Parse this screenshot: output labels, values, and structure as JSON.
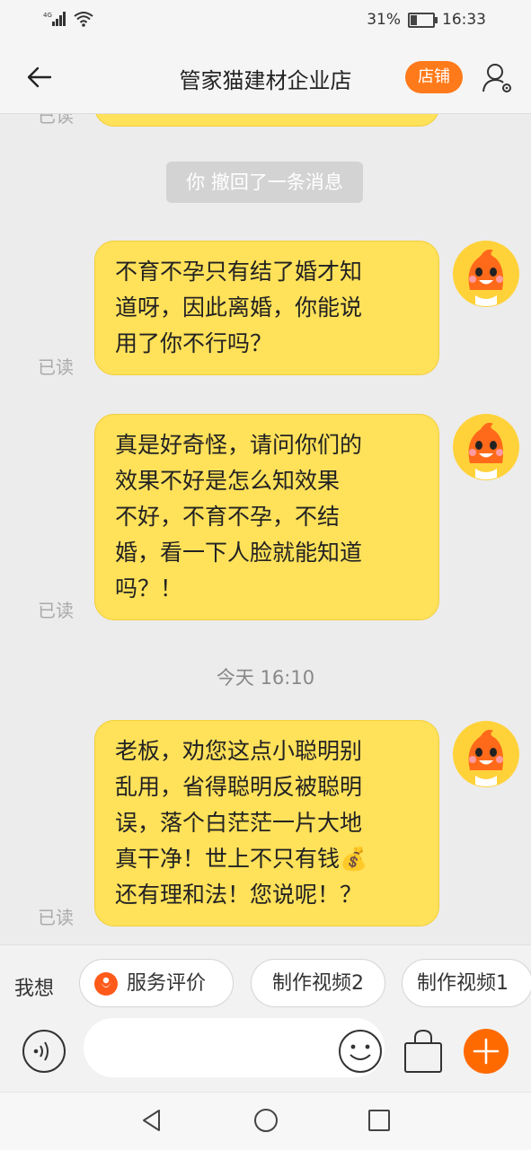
{
  "status_bar": {
    "network": "4G",
    "battery_text": "31%",
    "battery_level": 0.31,
    "time": "16:33"
  },
  "header": {
    "title": "管家猫建材企业店",
    "shop_button": "店铺"
  },
  "messages": {
    "read_label": "已读",
    "recall_notice": "你 撤回了一条消息",
    "m1": [
      "不育不孕只有结了婚才知",
      "道呀，因此离婚，你能说",
      "用了你不行吗？"
    ],
    "m2": [
      "真是好奇怪，请问你们的",
      "效果不好是怎么知效果",
      "不好，不育不孕，不结",
      "婚，看一下人脸就能知道",
      "吗？！"
    ],
    "time_label": "今天  16:10",
    "m3": [
      "老板，劝您这点小聪明别",
      "乱用，省得聪明反被聪明",
      "误，落个白茫茫一片大地",
      "真干净！世上不只有钱💰",
      "还有理和法！您说呢！？"
    ]
  },
  "suggestions": {
    "label": "我想",
    "chips": [
      "服务评价",
      "制作视频2",
      "制作视频1"
    ]
  },
  "input": {
    "placeholder": ""
  },
  "colors": {
    "accent": "#ff7a1a",
    "bubble": "#ffe15a",
    "plus": "#ff6a00"
  }
}
